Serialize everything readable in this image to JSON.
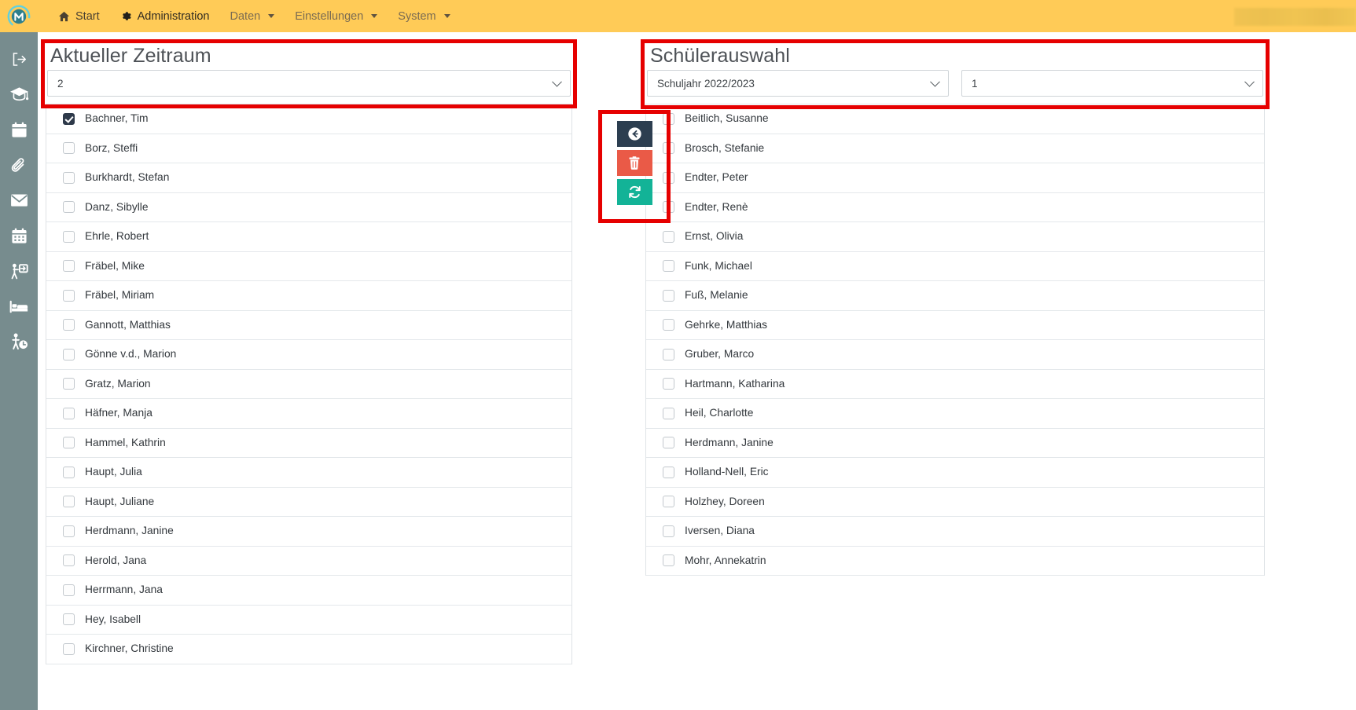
{
  "navbar": {
    "brand_icon": "app-logo-m-circle",
    "items": [
      {
        "label": "Start",
        "icon": "home-icon",
        "has_caret": false,
        "state": "normal"
      },
      {
        "label": "Administration",
        "icon": "gear-icon",
        "has_caret": false,
        "state": "active"
      },
      {
        "label": "Daten",
        "icon": "",
        "has_caret": true,
        "state": "dim"
      },
      {
        "label": "Einstellungen",
        "icon": "",
        "has_caret": true,
        "state": "dim"
      },
      {
        "label": "System",
        "icon": "",
        "has_caret": true,
        "state": "dim"
      }
    ],
    "background_color": "#ffcb57"
  },
  "sidebar": {
    "background_color": "#778c8e",
    "items": [
      {
        "icon": "logout-arrow-icon"
      },
      {
        "icon": "graduation-cap-icon"
      },
      {
        "icon": "calendar-icon"
      },
      {
        "icon": "paperclip-icon"
      },
      {
        "icon": "envelope-icon"
      },
      {
        "icon": "calendar-grid-icon"
      },
      {
        "icon": "person-presentation-icon"
      },
      {
        "icon": "bed-icon"
      },
      {
        "icon": "person-clock-icon"
      }
    ]
  },
  "annotations": {
    "highlight_color": "#e60000",
    "boxes": [
      "aktueller-zeitraum-panel",
      "action-buttons",
      "schuelerauswahl-panel"
    ]
  },
  "left_panel": {
    "title": "Aktueller Zeitraum",
    "period_select": {
      "value": "2",
      "caret_icon": "chevron-down-icon"
    },
    "students": [
      {
        "name": "Bachner, Tim",
        "checked": true
      },
      {
        "name": "Borz, Steffi",
        "checked": false
      },
      {
        "name": "Burkhardt, Stefan",
        "checked": false
      },
      {
        "name": "Danz, Sibylle",
        "checked": false
      },
      {
        "name": "Ehrle, Robert",
        "checked": false
      },
      {
        "name": "Fräbel, Mike",
        "checked": false
      },
      {
        "name": "Fräbel, Miriam",
        "checked": false
      },
      {
        "name": "Gannott, Matthias",
        "checked": false
      },
      {
        "name": "Gönne v.d., Marion",
        "checked": false
      },
      {
        "name": "Gratz, Marion",
        "checked": false
      },
      {
        "name": "Häfner, Manja",
        "checked": false
      },
      {
        "name": "Hammel, Kathrin",
        "checked": false
      },
      {
        "name": "Haupt, Julia",
        "checked": false
      },
      {
        "name": "Haupt, Juliane",
        "checked": false
      },
      {
        "name": "Herdmann, Janine",
        "checked": false
      },
      {
        "name": "Herold, Jana",
        "checked": false
      },
      {
        "name": "Herrmann, Jana",
        "checked": false
      },
      {
        "name": "Hey, Isabell",
        "checked": false
      },
      {
        "name": "Kirchner, Christine",
        "checked": false
      }
    ]
  },
  "right_panel": {
    "title": "Schülerauswahl",
    "schoolyear_select": {
      "value": "Schuljahr 2022/2023",
      "caret_icon": "chevron-down-icon"
    },
    "class_select": {
      "value": "1",
      "caret_icon": "chevron-down-icon"
    },
    "students": [
      {
        "name": "Beitlich, Susanne",
        "checked": false
      },
      {
        "name": "Brosch, Stefanie",
        "checked": false
      },
      {
        "name": "Endter, Peter",
        "checked": false
      },
      {
        "name": "Endter, Renè",
        "checked": false
      },
      {
        "name": "Ernst, Olivia",
        "checked": false
      },
      {
        "name": "Funk, Michael",
        "checked": false
      },
      {
        "name": "Fuß, Melanie",
        "checked": false
      },
      {
        "name": "Gehrke, Matthias",
        "checked": false
      },
      {
        "name": "Gruber, Marco",
        "checked": false
      },
      {
        "name": "Hartmann, Katharina",
        "checked": false
      },
      {
        "name": "Heil, Charlotte",
        "checked": false
      },
      {
        "name": "Herdmann, Janine",
        "checked": false
      },
      {
        "name": "Holland-Nell, Eric",
        "checked": false
      },
      {
        "name": "Holzhey, Doreen",
        "checked": false
      },
      {
        "name": "Iversen, Diana",
        "checked": false
      },
      {
        "name": "Mohr, Annekatrin",
        "checked": false
      }
    ]
  },
  "action_buttons": [
    {
      "id": "move-left",
      "icon": "arrow-left-circle-icon",
      "color": "#2c3e50"
    },
    {
      "id": "delete",
      "icon": "trash-icon",
      "color": "#ea5a47"
    },
    {
      "id": "refresh",
      "icon": "refresh-icon",
      "color": "#13b397"
    }
  ]
}
